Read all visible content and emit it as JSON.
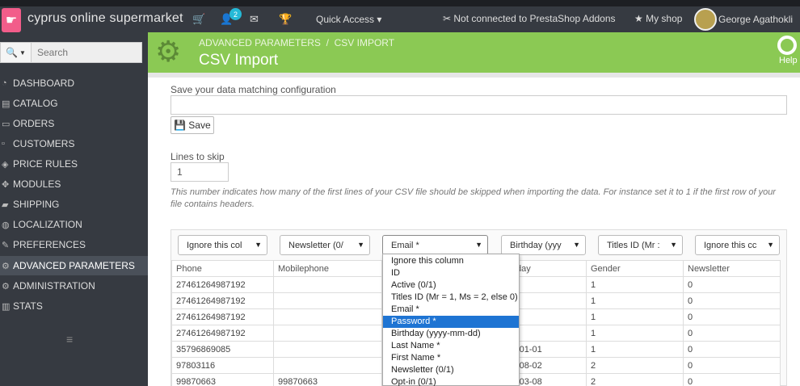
{
  "topbar": {
    "shop_name": "cyprus online supermarket",
    "notification_count": "2",
    "quick_access": "Quick Access ▾",
    "addons_status": "Not connected to PrestaShop Addons",
    "my_shop": "My shop",
    "user_name": "George Agathokli"
  },
  "search": {
    "placeholder": "Search"
  },
  "sidebar": {
    "items": [
      {
        "label": "DASHBOARD",
        "icon": "dashboard-icon"
      },
      {
        "label": "CATALOG",
        "icon": "catalog-icon"
      },
      {
        "label": "ORDERS",
        "icon": "orders-icon"
      },
      {
        "label": "CUSTOMERS",
        "icon": "customers-icon"
      },
      {
        "label": "PRICE RULES",
        "icon": "tag-icon"
      },
      {
        "label": "MODULES",
        "icon": "puzzle-icon"
      },
      {
        "label": "SHIPPING",
        "icon": "truck-icon"
      },
      {
        "label": "LOCALIZATION",
        "icon": "globe-icon"
      },
      {
        "label": "PREFERENCES",
        "icon": "wrench-icon"
      },
      {
        "label": "ADVANCED PARAMETERS",
        "icon": "cogs-icon",
        "active": true
      },
      {
        "label": "ADMINISTRATION",
        "icon": "cog-icon"
      },
      {
        "label": "STATS",
        "icon": "bar-chart-icon"
      }
    ]
  },
  "header": {
    "breadcrumb_parent": "ADVANCED PARAMETERS",
    "breadcrumb_sep": "/",
    "breadcrumb_current": "CSV IMPORT",
    "title": "CSV Import",
    "help_label": "Help"
  },
  "form": {
    "config_label": "Save your data matching configuration",
    "config_value": "",
    "save_label": "Save",
    "lines_label": "Lines to skip",
    "lines_value": "1",
    "lines_help": "This number indicates how many of the first lines of your CSV file should be skipped when importing the data. For instance set it to 1 if the first row of your file contains headers."
  },
  "column_selects": [
    "Ignore this col",
    "Newsletter (0/",
    "Email *",
    "Birthday (yyy",
    "Titles ID (Mr :",
    "Ignore this cc"
  ],
  "table": {
    "headers": [
      "Phone",
      "Mobilephone",
      "",
      "day",
      "Gender",
      "Newsletter"
    ],
    "rows": [
      [
        "27461264987192",
        "",
        "",
        "",
        "1",
        "0"
      ],
      [
        "27461264987192",
        "",
        "",
        "",
        "1",
        "0"
      ],
      [
        "27461264987192",
        "",
        "",
        "",
        "1",
        "0"
      ],
      [
        "27461264987192",
        "",
        "",
        "",
        "1",
        "0"
      ],
      [
        "35796869085",
        "",
        "",
        "-01-01",
        "1",
        "0"
      ],
      [
        "97803116",
        "",
        "",
        "-08-02",
        "2",
        "0"
      ],
      [
        "99870663",
        "99870663",
        "",
        "-03-08",
        "2",
        "0"
      ]
    ]
  },
  "dropdown": {
    "options": [
      "Ignore this column",
      "ID",
      "Active (0/1)",
      "Titles ID (Mr = 1, Ms = 2, else 0)",
      "Email *",
      "Password *",
      "Birthday (yyyy-mm-dd)",
      "Last Name *",
      "First Name *",
      "Newsletter (0/1)",
      "Opt-in (0/1)"
    ],
    "highlighted": "Password *"
  },
  "colors": {
    "header_green": "#8bc954",
    "sidebar_dark": "#363a41",
    "highlight_blue": "#1e74d3",
    "logo_pink": "#f25d8a"
  }
}
